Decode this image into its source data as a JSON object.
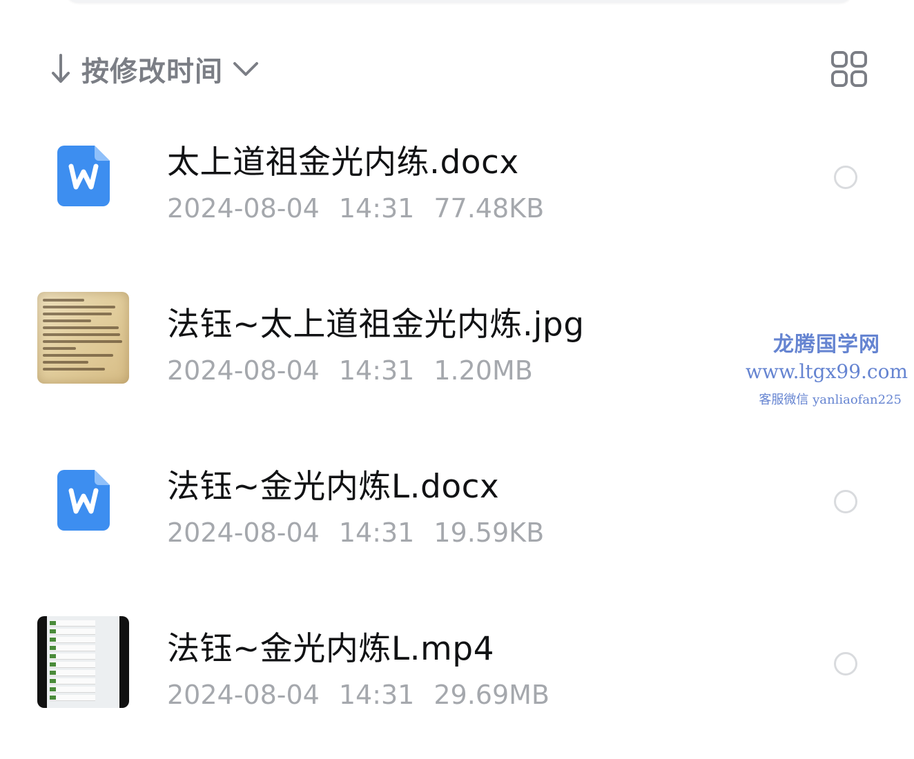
{
  "sort": {
    "label": "按修改时间",
    "direction_icon": "arrow-down-icon",
    "dropdown_icon": "chevron-down-icon"
  },
  "view_toggle_icon": "grid-view-icon",
  "files": [
    {
      "name": "太上道祖金光内练.docx",
      "date": "2024-08-04",
      "time": "14:31",
      "size": "77.48KB",
      "icon": "word-document-icon"
    },
    {
      "name": "法钰~太上道祖金光内炼.jpg",
      "date": "2024-08-04",
      "time": "14:31",
      "size": "1.20MB",
      "icon": "image-thumbnail"
    },
    {
      "name": "法钰~金光内炼L.docx",
      "date": "2024-08-04",
      "time": "14:31",
      "size": "19.59KB",
      "icon": "word-document-icon"
    },
    {
      "name": "法钰~金光内炼L.mp4",
      "date": "2024-08-04",
      "time": "14:31",
      "size": "29.69MB",
      "icon": "video-thumbnail"
    }
  ],
  "watermark": {
    "title": "龙腾国学网",
    "url": "www.ltgx99.com",
    "contact": "客服微信 yanliaofan225"
  },
  "colors": {
    "accent_blue": "#3d8ef0",
    "sort_text": "#7b7e85",
    "meta_text": "#a5a8ad",
    "watermark": "#4b6fc9"
  }
}
